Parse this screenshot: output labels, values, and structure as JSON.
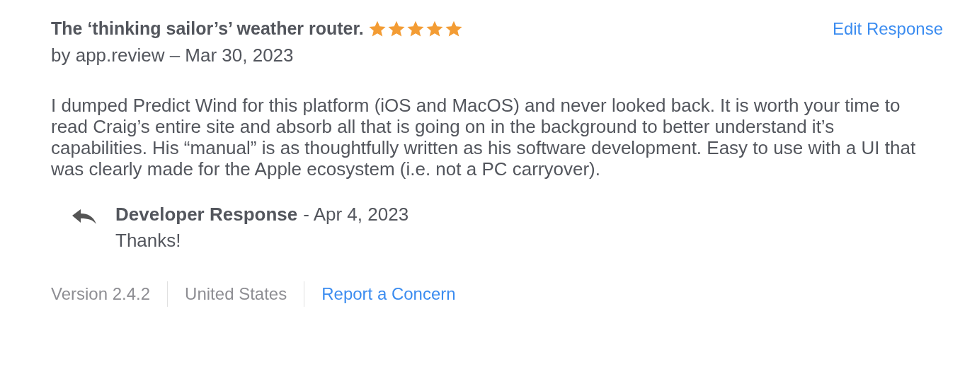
{
  "review": {
    "title": "The ‘thinking sailor’s’ weather router.",
    "stars": 5,
    "action": "Edit Response",
    "byline": "by app.review – Mar 30, 2023",
    "body": "I dumped Predict Wind for this platform (iOS and MacOS) and never looked back. It is worth your time to read Craig’s entire site and absorb all that is going on in the background to better understand it’s capabilities. His “manual” is as thoughtfully written as his software development. Easy to use with a UI that was clearly made for the Apple ecosystem (i.e. not a PC carryover)."
  },
  "developer_response": {
    "heading": "Developer Response",
    "date": "- Apr 4, 2023",
    "text": "Thanks!"
  },
  "footer": {
    "version": "Version 2.4.2",
    "country": "United States",
    "link": "Report a Concern"
  }
}
